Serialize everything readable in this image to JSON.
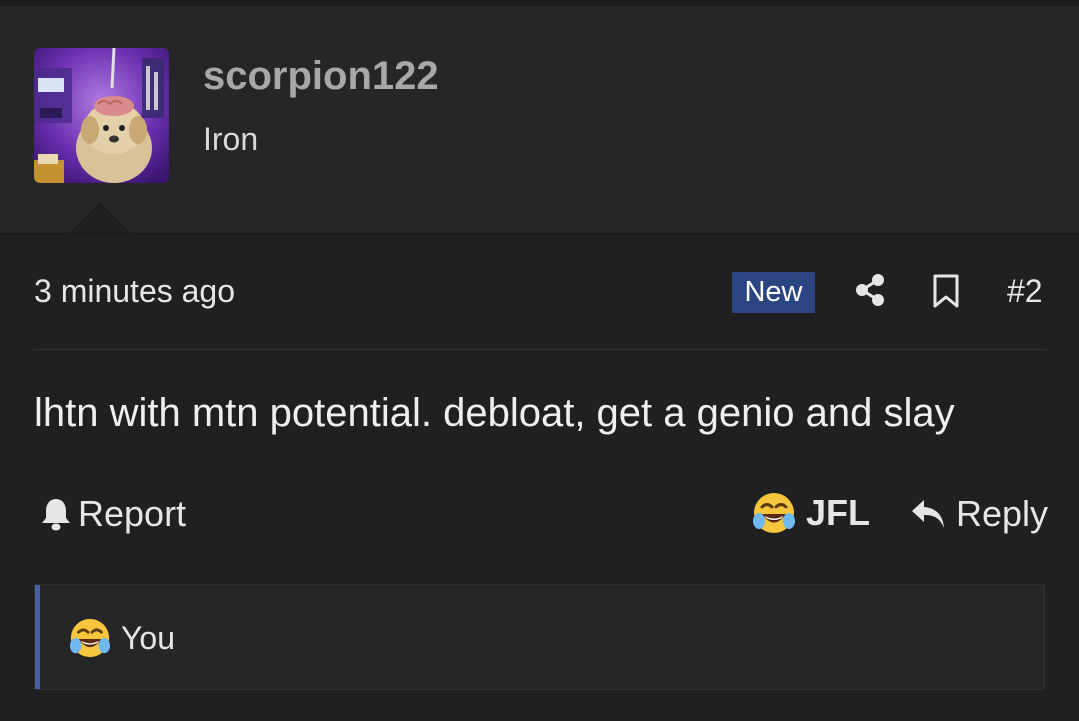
{
  "user": {
    "username": "scorpion122",
    "title": "Iron",
    "avatar_icon": "avatar-image"
  },
  "meta": {
    "time": "3 minutes ago",
    "badge": "New",
    "post_number": "#2"
  },
  "post": {
    "body": "lhtn with mtn potential. debloat, get a genio and slay"
  },
  "actions": {
    "report_label": "Report",
    "reaction_label": "JFL",
    "reply_label": "Reply"
  },
  "reactions": {
    "summary": "You"
  },
  "colors": {
    "background": "#202022",
    "header": "#262628",
    "badge": "#2b4583",
    "accent": "#4b5fa3",
    "username": "#a8a8ab"
  }
}
